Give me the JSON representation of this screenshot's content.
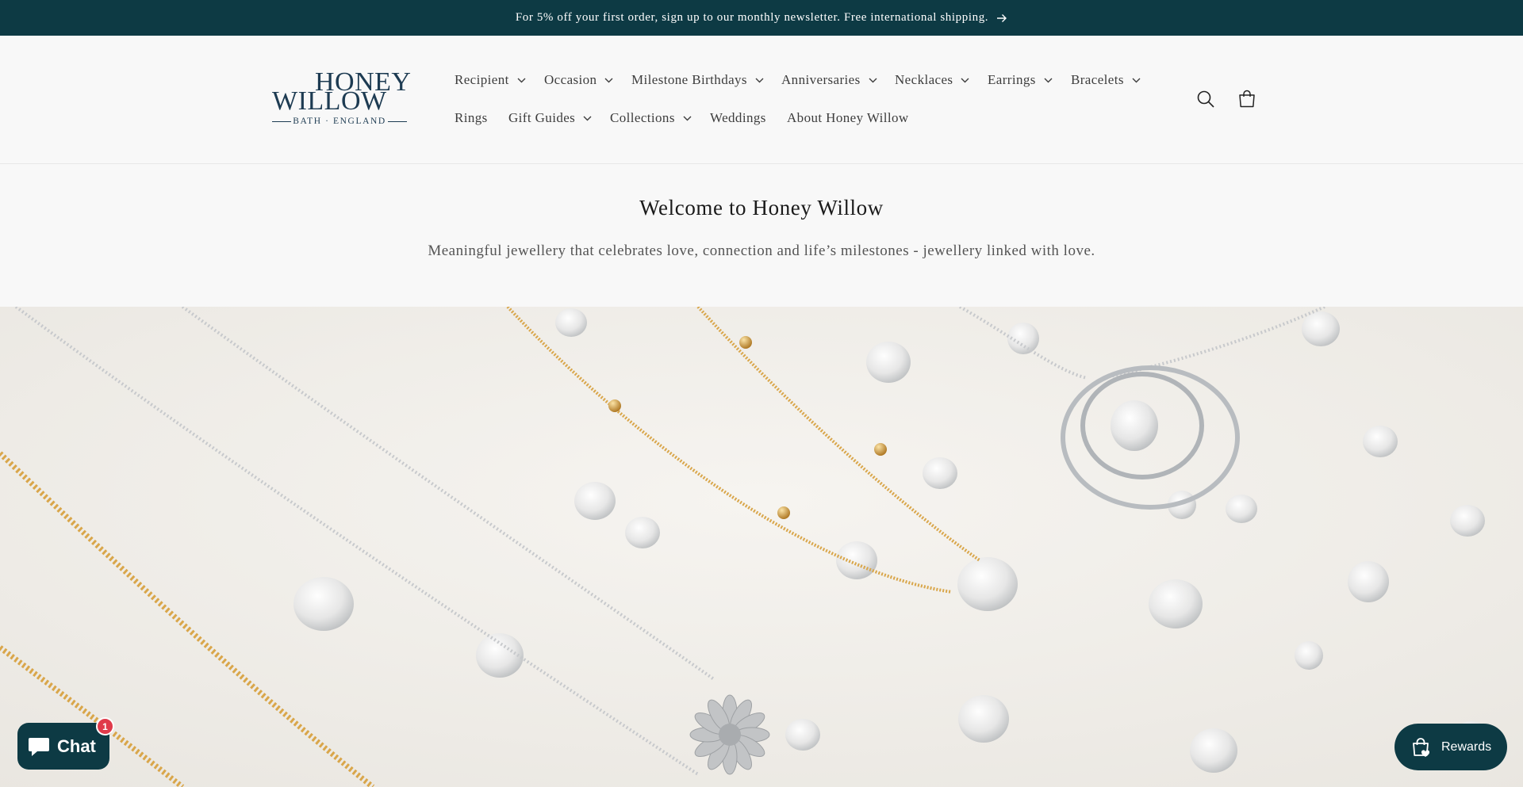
{
  "announcement": {
    "text": "For 5% off your first order, sign up to our monthly newsletter. Free international shipping."
  },
  "logo": {
    "line1": "HONEY",
    "line2": "WILLOW",
    "tagline": "BATH · ENGLAND"
  },
  "nav": {
    "row1": [
      {
        "label": "Recipient",
        "has_dropdown": true
      },
      {
        "label": "Occasion",
        "has_dropdown": true
      },
      {
        "label": "Milestone Birthdays",
        "has_dropdown": true
      },
      {
        "label": "Anniversaries",
        "has_dropdown": true
      },
      {
        "label": "Necklaces",
        "has_dropdown": true
      },
      {
        "label": "Earrings",
        "has_dropdown": true
      },
      {
        "label": "Bracelets",
        "has_dropdown": true
      }
    ],
    "row2": [
      {
        "label": "Rings",
        "has_dropdown": false
      },
      {
        "label": "Gift Guides",
        "has_dropdown": true
      },
      {
        "label": "Collections",
        "has_dropdown": true
      },
      {
        "label": "Weddings",
        "has_dropdown": false
      },
      {
        "label": "About Honey Willow",
        "has_dropdown": false
      }
    ]
  },
  "header_icons": [
    "search-icon",
    "cart-icon"
  ],
  "welcome": {
    "title": "Welcome to Honey Willow",
    "subtitle": "Meaningful jewellery that celebrates love, connection and life’s milestones - jewellery linked with love."
  },
  "chat": {
    "label": "Chat",
    "badge": "1"
  },
  "rewards": {
    "label": "Rewards"
  },
  "colors": {
    "brand_dark": "#0d3a44",
    "logo_navy": "#1d3b52",
    "page_bg": "#f8f8f8",
    "badge_red": "#e03a4a",
    "gold_chain": "#d9a64a",
    "silver_chain": "#c7c9cc"
  }
}
